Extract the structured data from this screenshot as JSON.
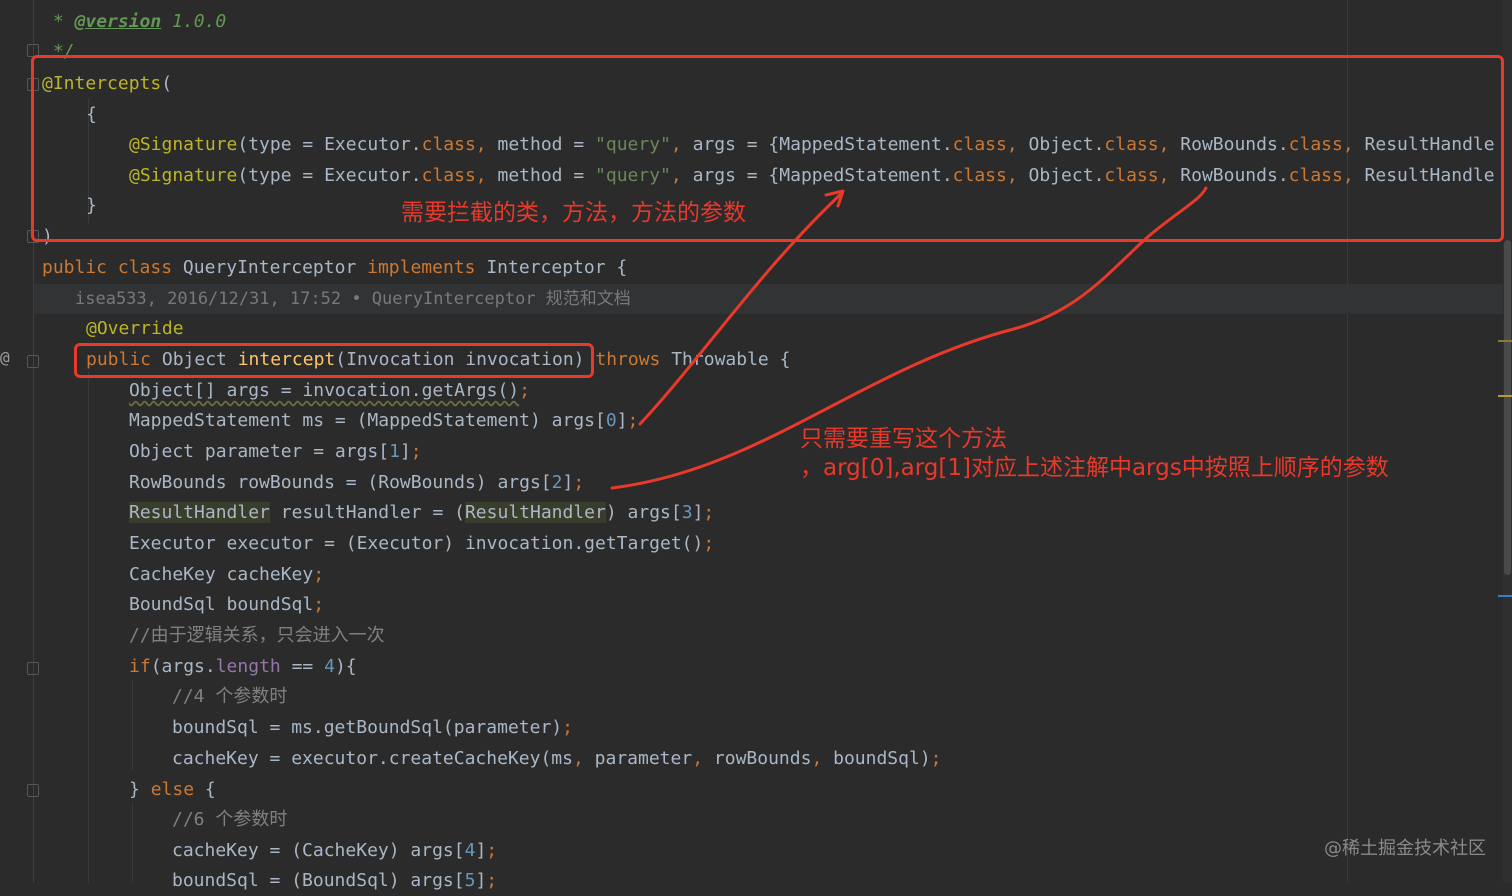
{
  "editor": {
    "javadoc_tail": {
      "star": " * ",
      "tag": "@version",
      "value": " 1.0.0",
      "close": " */"
    },
    "blame": "isea533, 2016/12/31, 17:52 • QueryInterceptor 规范和文档"
  },
  "annotations": {
    "box1_note": "需要拦截的类，方法，方法的参数",
    "box2_note_line1": "只需要重写这个方法",
    "box2_note_line2": "，arg[0],arg[1]对应上述注解中args中按照上顺序的参数"
  },
  "watermark": "@稀土掘金技术社区",
  "colors": {
    "background": "#2b2b2b",
    "annotation_red": "#e8392b",
    "keyword": "#cc7832",
    "annotation": "#bbb529",
    "string": "#6a8759",
    "number": "#6897bb",
    "function": "#ffc66d",
    "comment": "#808080",
    "field": "#9876aa"
  },
  "icons": [
    "fold-marker-icon",
    "override-gutter-icon"
  ],
  "code": {
    "intercepts": {
      "a": "@Intercepts",
      "b": "("
    },
    "open_brace": {
      "a": "{"
    },
    "sig1": {
      "a": "@Signature",
      "b": "(type = Executor.",
      "c": "class",
      "d": ", ",
      "e": "method = ",
      "f": "\"query\"",
      "g": ", ",
      "h": "args = {MappedStatement.",
      "i": "class",
      "j": ", ",
      "k": "Object.",
      "l": "class",
      "m": ", ",
      "n": "RowBounds.",
      "o": "class",
      "p": ", ",
      "q": "ResultHandle"
    },
    "sig2": {
      "a": "@Signature",
      "b": "(type = Executor.",
      "c": "class",
      "d": ", ",
      "e": "method = ",
      "f": "\"query\"",
      "g": ", ",
      "h": "args = {MappedStatement.",
      "i": "class",
      "j": ", ",
      "k": "Object.",
      "l": "class",
      "m": ", ",
      "n": "RowBounds.",
      "o": "class",
      "p": ", ",
      "q": "ResultHandle"
    },
    "close_brace": {
      "a": "}"
    },
    "close_paren": {
      "a": ")"
    },
    "class_decl": {
      "a": "public class ",
      "b": "QueryInterceptor ",
      "c": "implements ",
      "d": "Interceptor {"
    },
    "override": {
      "a": "@Override"
    },
    "method_sig": {
      "a": "public ",
      "b": "Object ",
      "c": "intercept",
      "d": "(Invocation invocation) ",
      "e": "throws ",
      "f": "Throwable {"
    },
    "args_line": {
      "a": "Object[] args = invocation.getArgs()",
      "b": ";"
    },
    "ms_line": {
      "a": "MappedStatement ms = (MappedStatement) args[",
      "b": "0",
      "c": "]",
      "d": ";"
    },
    "param_line": {
      "a": "Object parameter = args[",
      "b": "1",
      "c": "]",
      "d": ";"
    },
    "rb_line": {
      "a": "RowBounds rowBounds = (RowBounds) args[",
      "b": "2",
      "c": "]",
      "d": ";"
    },
    "rh_line": {
      "a": "ResultHandler",
      "b": " resultHandler = (",
      "c": "ResultHandler",
      "d": ") args[",
      "e": "3",
      "f": "]",
      "g": ";"
    },
    "exec_line": {
      "a": "Executor executor = (Executor) invocation.getTarget()",
      "b": ";"
    },
    "ck_decl": {
      "a": "CacheKey cacheKey",
      "b": ";"
    },
    "bs_decl": {
      "a": "BoundSql boundSql",
      "b": ";"
    },
    "comment1": {
      "a": "//由于逻辑关系，只会进入一次"
    },
    "if_line": {
      "a": "if",
      "b": "(args.",
      "c": "length",
      "d": " == ",
      "e": "4",
      "f": "){"
    },
    "comment2": {
      "a": "//4 个参数时"
    },
    "bs_assign": {
      "a": "boundSql = ms.getBoundSql(parameter)",
      "b": ";"
    },
    "ck_assign": {
      "a": "cacheKey = executor.createCacheKey(ms",
      "b": ", ",
      "c": "parameter",
      "d": ", ",
      "e": "rowBounds",
      "f": ", ",
      "g": "boundSql)",
      "h": ";"
    },
    "else_line": {
      "a": "} ",
      "b": "else",
      "c": " {"
    },
    "comment3": {
      "a": "//6 个参数时"
    },
    "ck_cast": {
      "a": "cacheKey = (CacheKey) args[",
      "b": "4",
      "c": "]",
      "d": ";"
    },
    "bs_cast": {
      "a": "boundSql = (BoundSql) args[",
      "b": "5",
      "c": "]",
      "d": ";"
    }
  }
}
